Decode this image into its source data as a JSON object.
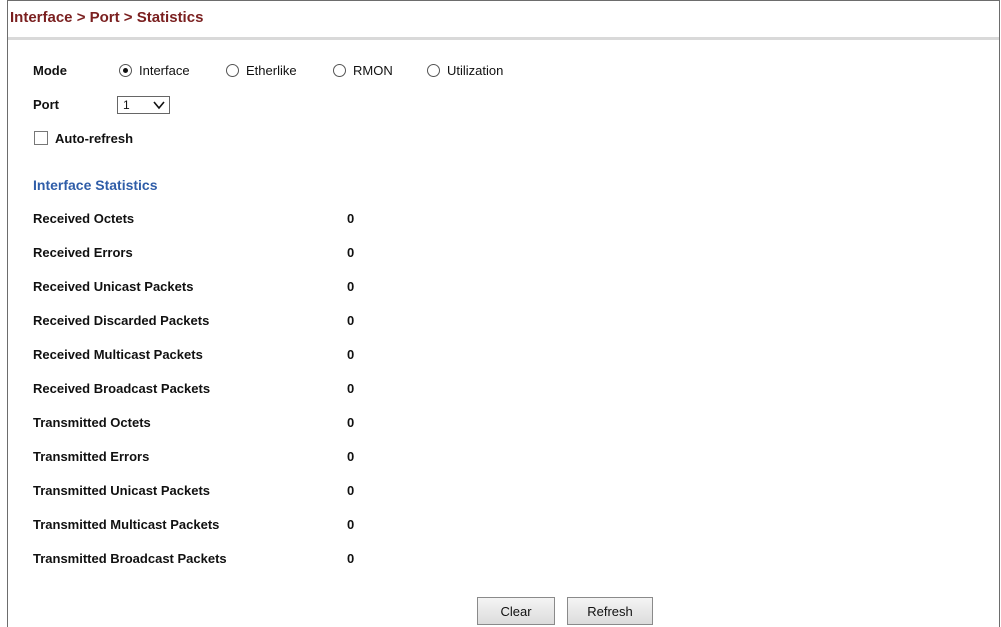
{
  "breadcrumb": "Interface > Port > Statistics",
  "mode": {
    "label": "Mode",
    "options": [
      {
        "label": "Interface",
        "selected": true
      },
      {
        "label": "Etherlike",
        "selected": false
      },
      {
        "label": "RMON",
        "selected": false
      },
      {
        "label": "Utilization",
        "selected": false
      }
    ]
  },
  "port": {
    "label": "Port",
    "value": "1"
  },
  "auto_refresh": {
    "label": "Auto-refresh",
    "checked": false
  },
  "section_title": "Interface Statistics",
  "stats": [
    {
      "name": "Received Octets",
      "value": "0"
    },
    {
      "name": "Received Errors",
      "value": "0"
    },
    {
      "name": "Received Unicast Packets",
      "value": "0"
    },
    {
      "name": "Received Discarded Packets",
      "value": "0"
    },
    {
      "name": "Received Multicast Packets",
      "value": "0"
    },
    {
      "name": "Received Broadcast Packets",
      "value": "0"
    },
    {
      "name": "Transmitted Octets",
      "value": "0"
    },
    {
      "name": "Transmitted Errors",
      "value": "0"
    },
    {
      "name": "Transmitted Unicast Packets",
      "value": "0"
    },
    {
      "name": "Transmitted Multicast Packets",
      "value": "0"
    },
    {
      "name": "Transmitted Broadcast Packets",
      "value": "0"
    }
  ],
  "buttons": {
    "clear": "Clear",
    "refresh": "Refresh"
  },
  "colors": {
    "title": "#7a1f1f",
    "section": "#2f5da8"
  }
}
